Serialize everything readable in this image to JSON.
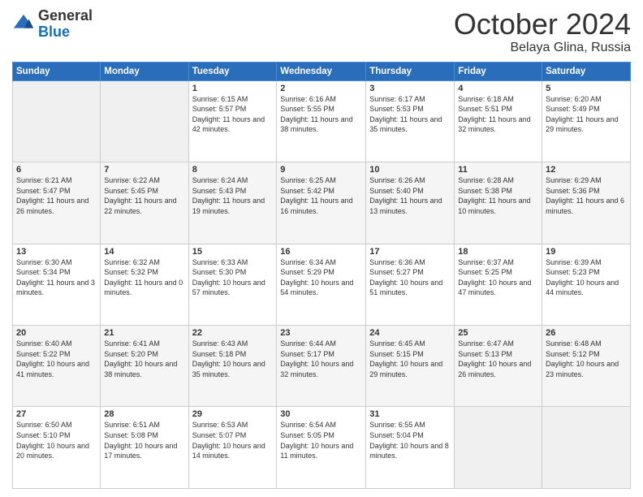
{
  "header": {
    "logo_general": "General",
    "logo_blue": "Blue",
    "month_title": "October 2024",
    "location": "Belaya Glina, Russia"
  },
  "days_of_week": [
    "Sunday",
    "Monday",
    "Tuesday",
    "Wednesday",
    "Thursday",
    "Friday",
    "Saturday"
  ],
  "weeks": [
    [
      {
        "day": "",
        "sunrise": "",
        "sunset": "",
        "daylight": "",
        "empty": true
      },
      {
        "day": "",
        "sunrise": "",
        "sunset": "",
        "daylight": "",
        "empty": true
      },
      {
        "day": "1",
        "sunrise": "Sunrise: 6:15 AM",
        "sunset": "Sunset: 5:57 PM",
        "daylight": "Daylight: 11 hours and 42 minutes."
      },
      {
        "day": "2",
        "sunrise": "Sunrise: 6:16 AM",
        "sunset": "Sunset: 5:55 PM",
        "daylight": "Daylight: 11 hours and 38 minutes."
      },
      {
        "day": "3",
        "sunrise": "Sunrise: 6:17 AM",
        "sunset": "Sunset: 5:53 PM",
        "daylight": "Daylight: 11 hours and 35 minutes."
      },
      {
        "day": "4",
        "sunrise": "Sunrise: 6:18 AM",
        "sunset": "Sunset: 5:51 PM",
        "daylight": "Daylight: 11 hours and 32 minutes."
      },
      {
        "day": "5",
        "sunrise": "Sunrise: 6:20 AM",
        "sunset": "Sunset: 5:49 PM",
        "daylight": "Daylight: 11 hours and 29 minutes."
      }
    ],
    [
      {
        "day": "6",
        "sunrise": "Sunrise: 6:21 AM",
        "sunset": "Sunset: 5:47 PM",
        "daylight": "Daylight: 11 hours and 26 minutes."
      },
      {
        "day": "7",
        "sunrise": "Sunrise: 6:22 AM",
        "sunset": "Sunset: 5:45 PM",
        "daylight": "Daylight: 11 hours and 22 minutes."
      },
      {
        "day": "8",
        "sunrise": "Sunrise: 6:24 AM",
        "sunset": "Sunset: 5:43 PM",
        "daylight": "Daylight: 11 hours and 19 minutes."
      },
      {
        "day": "9",
        "sunrise": "Sunrise: 6:25 AM",
        "sunset": "Sunset: 5:42 PM",
        "daylight": "Daylight: 11 hours and 16 minutes."
      },
      {
        "day": "10",
        "sunrise": "Sunrise: 6:26 AM",
        "sunset": "Sunset: 5:40 PM",
        "daylight": "Daylight: 11 hours and 13 minutes."
      },
      {
        "day": "11",
        "sunrise": "Sunrise: 6:28 AM",
        "sunset": "Sunset: 5:38 PM",
        "daylight": "Daylight: 11 hours and 10 minutes."
      },
      {
        "day": "12",
        "sunrise": "Sunrise: 6:29 AM",
        "sunset": "Sunset: 5:36 PM",
        "daylight": "Daylight: 11 hours and 6 minutes."
      }
    ],
    [
      {
        "day": "13",
        "sunrise": "Sunrise: 6:30 AM",
        "sunset": "Sunset: 5:34 PM",
        "daylight": "Daylight: 11 hours and 3 minutes."
      },
      {
        "day": "14",
        "sunrise": "Sunrise: 6:32 AM",
        "sunset": "Sunset: 5:32 PM",
        "daylight": "Daylight: 11 hours and 0 minutes."
      },
      {
        "day": "15",
        "sunrise": "Sunrise: 6:33 AM",
        "sunset": "Sunset: 5:30 PM",
        "daylight": "Daylight: 10 hours and 57 minutes."
      },
      {
        "day": "16",
        "sunrise": "Sunrise: 6:34 AM",
        "sunset": "Sunset: 5:29 PM",
        "daylight": "Daylight: 10 hours and 54 minutes."
      },
      {
        "day": "17",
        "sunrise": "Sunrise: 6:36 AM",
        "sunset": "Sunset: 5:27 PM",
        "daylight": "Daylight: 10 hours and 51 minutes."
      },
      {
        "day": "18",
        "sunrise": "Sunrise: 6:37 AM",
        "sunset": "Sunset: 5:25 PM",
        "daylight": "Daylight: 10 hours and 47 minutes."
      },
      {
        "day": "19",
        "sunrise": "Sunrise: 6:39 AM",
        "sunset": "Sunset: 5:23 PM",
        "daylight": "Daylight: 10 hours and 44 minutes."
      }
    ],
    [
      {
        "day": "20",
        "sunrise": "Sunrise: 6:40 AM",
        "sunset": "Sunset: 5:22 PM",
        "daylight": "Daylight: 10 hours and 41 minutes."
      },
      {
        "day": "21",
        "sunrise": "Sunrise: 6:41 AM",
        "sunset": "Sunset: 5:20 PM",
        "daylight": "Daylight: 10 hours and 38 minutes."
      },
      {
        "day": "22",
        "sunrise": "Sunrise: 6:43 AM",
        "sunset": "Sunset: 5:18 PM",
        "daylight": "Daylight: 10 hours and 35 minutes."
      },
      {
        "day": "23",
        "sunrise": "Sunrise: 6:44 AM",
        "sunset": "Sunset: 5:17 PM",
        "daylight": "Daylight: 10 hours and 32 minutes."
      },
      {
        "day": "24",
        "sunrise": "Sunrise: 6:45 AM",
        "sunset": "Sunset: 5:15 PM",
        "daylight": "Daylight: 10 hours and 29 minutes."
      },
      {
        "day": "25",
        "sunrise": "Sunrise: 6:47 AM",
        "sunset": "Sunset: 5:13 PM",
        "daylight": "Daylight: 10 hours and 26 minutes."
      },
      {
        "day": "26",
        "sunrise": "Sunrise: 6:48 AM",
        "sunset": "Sunset: 5:12 PM",
        "daylight": "Daylight: 10 hours and 23 minutes."
      }
    ],
    [
      {
        "day": "27",
        "sunrise": "Sunrise: 6:50 AM",
        "sunset": "Sunset: 5:10 PM",
        "daylight": "Daylight: 10 hours and 20 minutes."
      },
      {
        "day": "28",
        "sunrise": "Sunrise: 6:51 AM",
        "sunset": "Sunset: 5:08 PM",
        "daylight": "Daylight: 10 hours and 17 minutes."
      },
      {
        "day": "29",
        "sunrise": "Sunrise: 6:53 AM",
        "sunset": "Sunset: 5:07 PM",
        "daylight": "Daylight: 10 hours and 14 minutes."
      },
      {
        "day": "30",
        "sunrise": "Sunrise: 6:54 AM",
        "sunset": "Sunset: 5:05 PM",
        "daylight": "Daylight: 10 hours and 11 minutes."
      },
      {
        "day": "31",
        "sunrise": "Sunrise: 6:55 AM",
        "sunset": "Sunset: 5:04 PM",
        "daylight": "Daylight: 10 hours and 8 minutes."
      },
      {
        "day": "",
        "sunrise": "",
        "sunset": "",
        "daylight": "",
        "empty": true
      },
      {
        "day": "",
        "sunrise": "",
        "sunset": "",
        "daylight": "",
        "empty": true
      }
    ]
  ]
}
